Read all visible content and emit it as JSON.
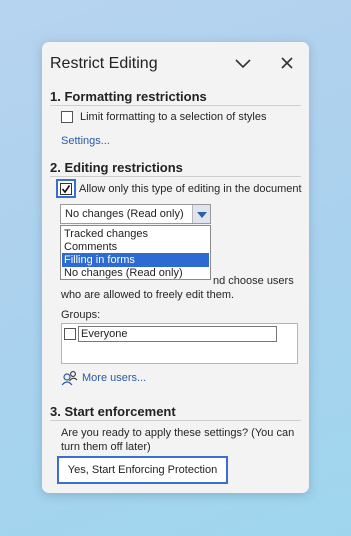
{
  "panel": {
    "title": "Restrict Editing",
    "collapse_icon": "chevron-down-icon",
    "close_icon": "close-icon"
  },
  "formatting": {
    "heading": "1. Formatting restrictions",
    "limit_label": "Limit formatting to a selection of styles",
    "limit_checked": false,
    "settings_link": "Settings..."
  },
  "editing": {
    "heading": "2. Editing restrictions",
    "allow_label": "Allow only this type of editing in the document",
    "allow_checked": true,
    "selected_value": "No changes (Read only)",
    "options": [
      "Tracked changes",
      "Comments",
      "Filling in forms",
      "No changes (Read only)"
    ],
    "highlighted_option": "Filling in forms",
    "exceptions_text_line1": "nd choose users",
    "exceptions_text_line2": "who are allowed to freely edit them.",
    "groups_label": "Groups:",
    "group_name": "Everyone",
    "more_users_link": "More users..."
  },
  "enforcement": {
    "heading": "3. Start enforcement",
    "prompt_line1": "Are you ready to apply these settings? (You can",
    "prompt_line2": "turn them off later)",
    "button_label": "Yes, Start Enforcing Protection"
  },
  "colors": {
    "accent": "#3b6ed4",
    "link": "#2b5aa8",
    "selection": "#2d6ad1"
  }
}
